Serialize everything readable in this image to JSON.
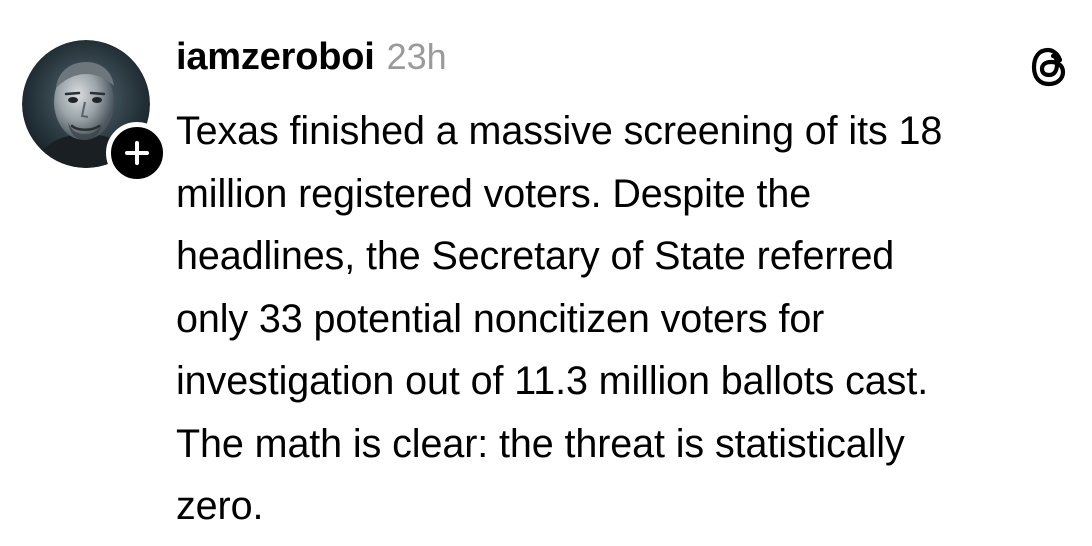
{
  "post": {
    "username": "iamzeroboi",
    "timestamp": "23h",
    "text_lines": [
      "Texas finished a massive screening of its 18",
      "million registered voters. Despite the",
      "headlines, the Secretary of State referred",
      "only 33 potential noncitizen voters for",
      "investigation out of 11.3 million ballots cast.",
      "The math is clear: the threat is statistically",
      "zero."
    ]
  },
  "icons": {
    "avatar": "profile-photo",
    "follow": "plus-icon",
    "app_logo": "threads-icon"
  },
  "colors": {
    "text": "#000000",
    "muted": "#9a9a9a",
    "background": "#ffffff",
    "badge": "#000000"
  }
}
